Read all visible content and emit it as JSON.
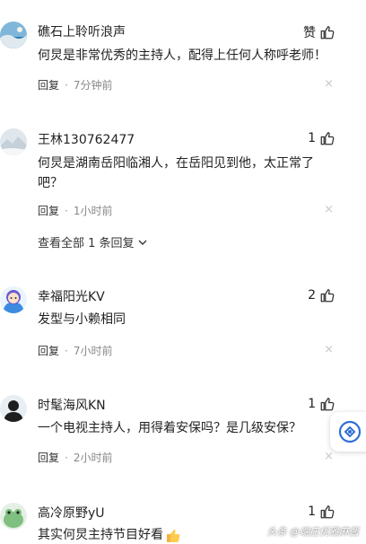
{
  "comments": [
    {
      "username": "礁石上聆听浪声",
      "likes": "赞",
      "content": "何炅是非常优秀的主持人，配得上任何人称呼老师！",
      "reply_label": "回复",
      "time": "7分钟前"
    },
    {
      "username": "王林130762477",
      "likes": "1",
      "content": "何炅是湖南岳阳临湘人，在岳阳见到他，太正常了吧？",
      "reply_label": "回复",
      "time": "1小时前",
      "view_all": "查看全部 1 条回复"
    },
    {
      "username": "幸福阳光KV",
      "likes": "2",
      "content": "发型与小赖相同",
      "reply_label": "回复",
      "time": "7小时前"
    },
    {
      "username": "时髦海风KN",
      "likes": "1",
      "content": "一个电视主持人，用得着安保吗？是几级安保？",
      "reply_label": "回复",
      "time": "2小时前"
    },
    {
      "username": "高冷原野yU",
      "likes": "1",
      "content": "其实何炅主持节目好看"
    }
  ],
  "separator": "·",
  "close_glyph": "×",
  "watermark": "头条 @端庄优雅麻酱",
  "colors": {
    "accent_blue": "#2f6fd6",
    "muted": "#888888"
  }
}
